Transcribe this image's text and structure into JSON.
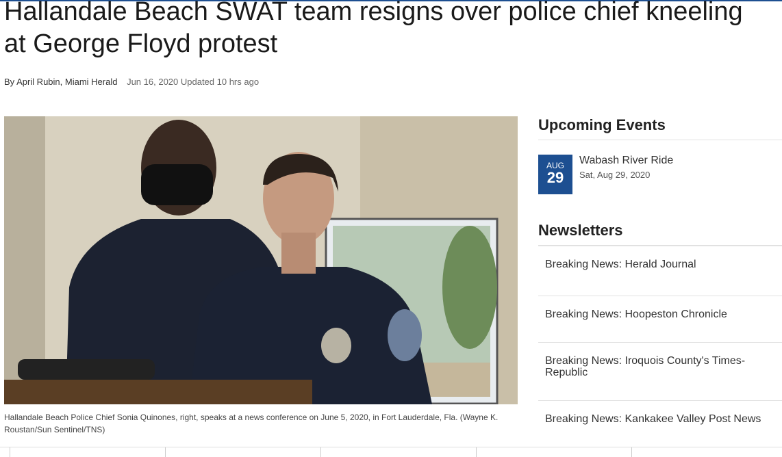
{
  "article": {
    "headline": "Hallandale Beach SWAT team resigns over police chief kneeling at George Floyd protest",
    "byline": "By April Rubin, Miami Herald",
    "date": "Jun 16, 2020 Updated 10 hrs ago",
    "caption": "Hallandale Beach Police Chief Sonia Quinones, right, speaks at a news conference on June 5, 2020, in Fort Lauderdale, Fla. (Wayne K. Roustan/Sun Sentinel/TNS)"
  },
  "sidebar": {
    "events_title": "Upcoming Events",
    "event": {
      "month": "AUG",
      "day": "29",
      "title": "Wabash River Ride",
      "date": "Sat, Aug 29, 2020"
    },
    "newsletters_title": "Newsletters",
    "newsletters": [
      "Breaking News: Herald Journal",
      "Breaking News: Hoopeston Chronicle",
      "Breaking News: Iroquois County's Times-Republic",
      "Breaking News: Kankakee Valley Post News"
    ]
  },
  "colors": {
    "accent": "#1d4f91"
  }
}
